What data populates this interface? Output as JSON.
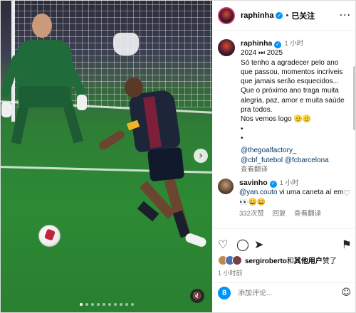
{
  "header": {
    "username": "raphinha",
    "verified_glyph": "✓",
    "separator": "•",
    "follow_label": "已关注",
    "more_icon": "more-horizontal-icon",
    "more_glyph": "···"
  },
  "media": {
    "next_glyph": "›",
    "mute_glyph": "🔇",
    "slide_count": 10,
    "active_slide": 1
  },
  "caption": {
    "username": "raphinha",
    "time": "1 小时",
    "lines": [
      "2024 ⏭ 2025",
      "Só tenho a agradecer pelo ano que passou, momentos incríveis que jamais serão esquecidos...",
      "Que o próximo ano traga muita alegria, paz, amor e muita saúde pra todos.",
      "Nos vemos logo 🫡🫡",
      "•",
      "•"
    ],
    "mentions_line1": "@thegoalfactory_",
    "mentions_line2a": "@cbf_futebol",
    "mentions_line2b": "@fcbarcelona",
    "translate_label": "查看翻译"
  },
  "comment": {
    "username": "savinho",
    "time": "1 小时",
    "mention": "@yan.couto",
    "text": " vi uma caneta aí em 👀😄😄",
    "likes": "332次赞",
    "reply_label": "回复",
    "translate_label": "查看翻译"
  },
  "actions": {
    "like_glyph": "♡",
    "comment_glyph": "◯",
    "share_glyph": "➤",
    "save_glyph": "⚑",
    "liked_by_user": "sergiroberto",
    "liked_by_connector": "和",
    "liked_by_others": "其他用户",
    "liked_by_suffix": "赞了",
    "ago": "1 小时前"
  },
  "add_comment": {
    "placeholder": "添加评论...",
    "avatar_letter": "8",
    "emoji_glyph": "☺"
  },
  "colors": {
    "accent": "#0095f6",
    "link": "#00376b",
    "muted": "#737373"
  }
}
